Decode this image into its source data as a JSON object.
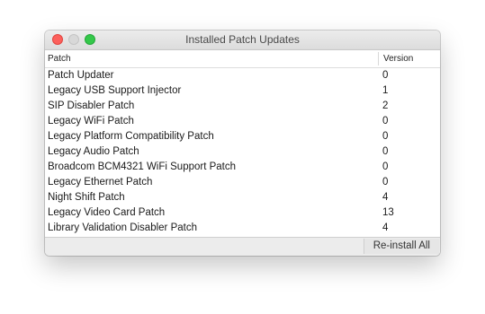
{
  "window": {
    "title": "Installed Patch Updates"
  },
  "table": {
    "columns": [
      "Patch",
      "Version"
    ],
    "rows": [
      {
        "patch": "Patch Updater",
        "version": "0"
      },
      {
        "patch": "Legacy USB Support Injector",
        "version": "1"
      },
      {
        "patch": "SIP Disabler Patch",
        "version": "2"
      },
      {
        "patch": "Legacy WiFi Patch",
        "version": "0"
      },
      {
        "patch": "Legacy Platform Compatibility Patch",
        "version": "0"
      },
      {
        "patch": "Legacy Audio Patch",
        "version": "0"
      },
      {
        "patch": "Broadcom BCM4321 WiFi Support Patch",
        "version": "0"
      },
      {
        "patch": "Legacy Ethernet Patch",
        "version": "0"
      },
      {
        "patch": "Night Shift Patch",
        "version": "4"
      },
      {
        "patch": "Legacy Video Card Patch",
        "version": "13"
      },
      {
        "patch": "Library Validation Disabler Patch",
        "version": "4"
      }
    ]
  },
  "footer": {
    "reinstall_label": "Re-install All"
  }
}
